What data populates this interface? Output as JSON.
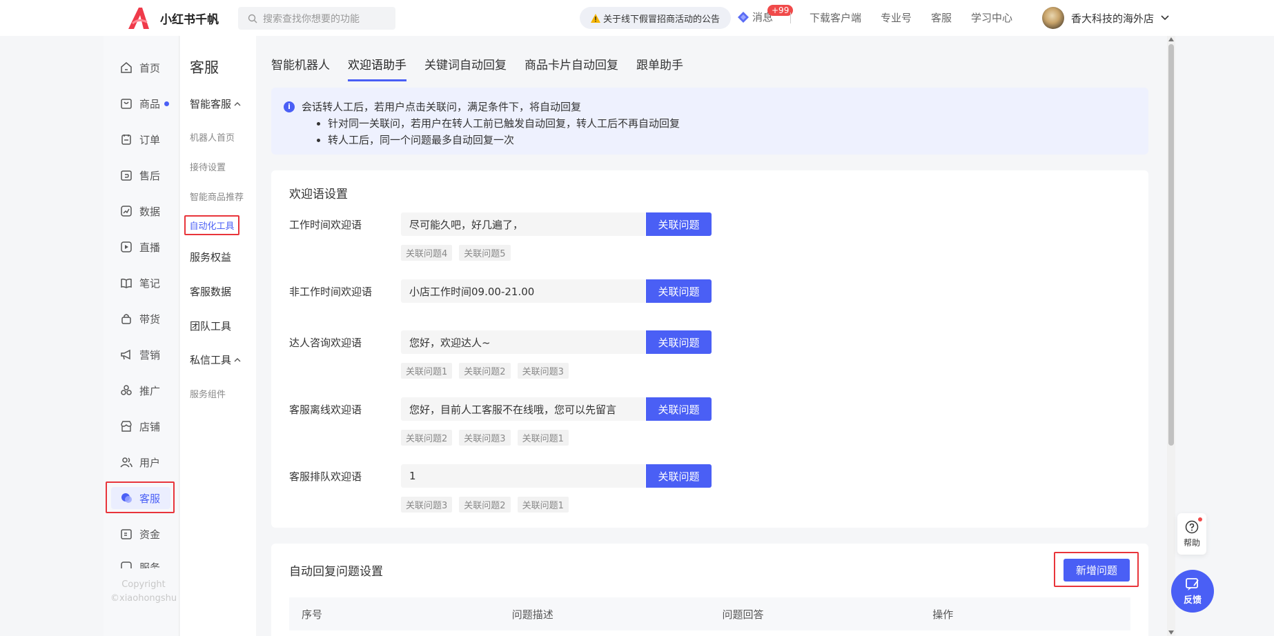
{
  "app": {
    "name": "小红书千帆",
    "search_placeholder": "搜索查找你想要的功能",
    "notice": "关于线下假冒招商活动的公告",
    "messages_label": "消息",
    "messages_badge": "+99",
    "links": [
      "下载客户端",
      "专业号",
      "客服",
      "学习中心"
    ],
    "shop_name": "香大科技的海外店"
  },
  "nav1": {
    "items": [
      "首页",
      "商品",
      "订单",
      "售后",
      "数据",
      "直播",
      "笔记",
      "带货",
      "营销",
      "推广",
      "店铺",
      "用户",
      "客服",
      "资金",
      "服务"
    ],
    "copyright_1": "Copyright",
    "copyright_2": "©xiaohongshu"
  },
  "nav2": {
    "title": "客服",
    "group1": "智能客服",
    "sub1": [
      "机器人首页",
      "接待设置",
      "智能商品推荐",
      "自动化工具"
    ],
    "items": [
      "服务权益",
      "客服数据",
      "团队工具"
    ],
    "group2": "私信工具",
    "sub2": [
      "服务组件"
    ]
  },
  "tabs": [
    "智能机器人",
    "欢迎语助手",
    "关键词自动回复",
    "商品卡片自动回复",
    "跟单助手"
  ],
  "tip": {
    "main": "会话转人工后，若用户点击关联问，满足条件下，将自动回复",
    "bullets": [
      "针对同一关联问，若用户在转人工前已触发自动回复，转人工后不再自动回复",
      "转人工后，同一个问题最多自动回复一次"
    ]
  },
  "welcome": {
    "title": "欢迎语设置",
    "button_label": "关联问题",
    "rows": [
      {
        "label": "工作时间欢迎语",
        "value": "尽可能久吧，好几遍了，",
        "tags": [
          "关联问题4",
          "关联问题5"
        ]
      },
      {
        "label": "非工作时间欢迎语",
        "value": "小店工作时间09.00-21.00",
        "tags": []
      },
      {
        "label": "达人咨询欢迎语",
        "value": "您好，欢迎达人~",
        "tags": [
          "关联问题1",
          "关联问题2",
          "关联问题3"
        ]
      },
      {
        "label": "客服离线欢迎语",
        "value": "您好，目前人工客服不在线哦，您可以先留言",
        "tags": [
          "关联问题2",
          "关联问题3",
          "关联问题1"
        ]
      },
      {
        "label": "客服排队欢迎语",
        "value": "1",
        "tags": [
          "关联问题3",
          "关联问题2",
          "关联问题1"
        ]
      }
    ]
  },
  "auto_reply": {
    "title": "自动回复问题设置",
    "add_button": "新增问题",
    "columns": [
      "序号",
      "问题描述",
      "问题回答",
      "操作"
    ]
  },
  "floating": {
    "help": "帮助",
    "feedback": "反馈"
  },
  "colors": {
    "accent": "#4a5ff5",
    "highlight_border": "#e8343a",
    "badge": "#f04a4a"
  }
}
